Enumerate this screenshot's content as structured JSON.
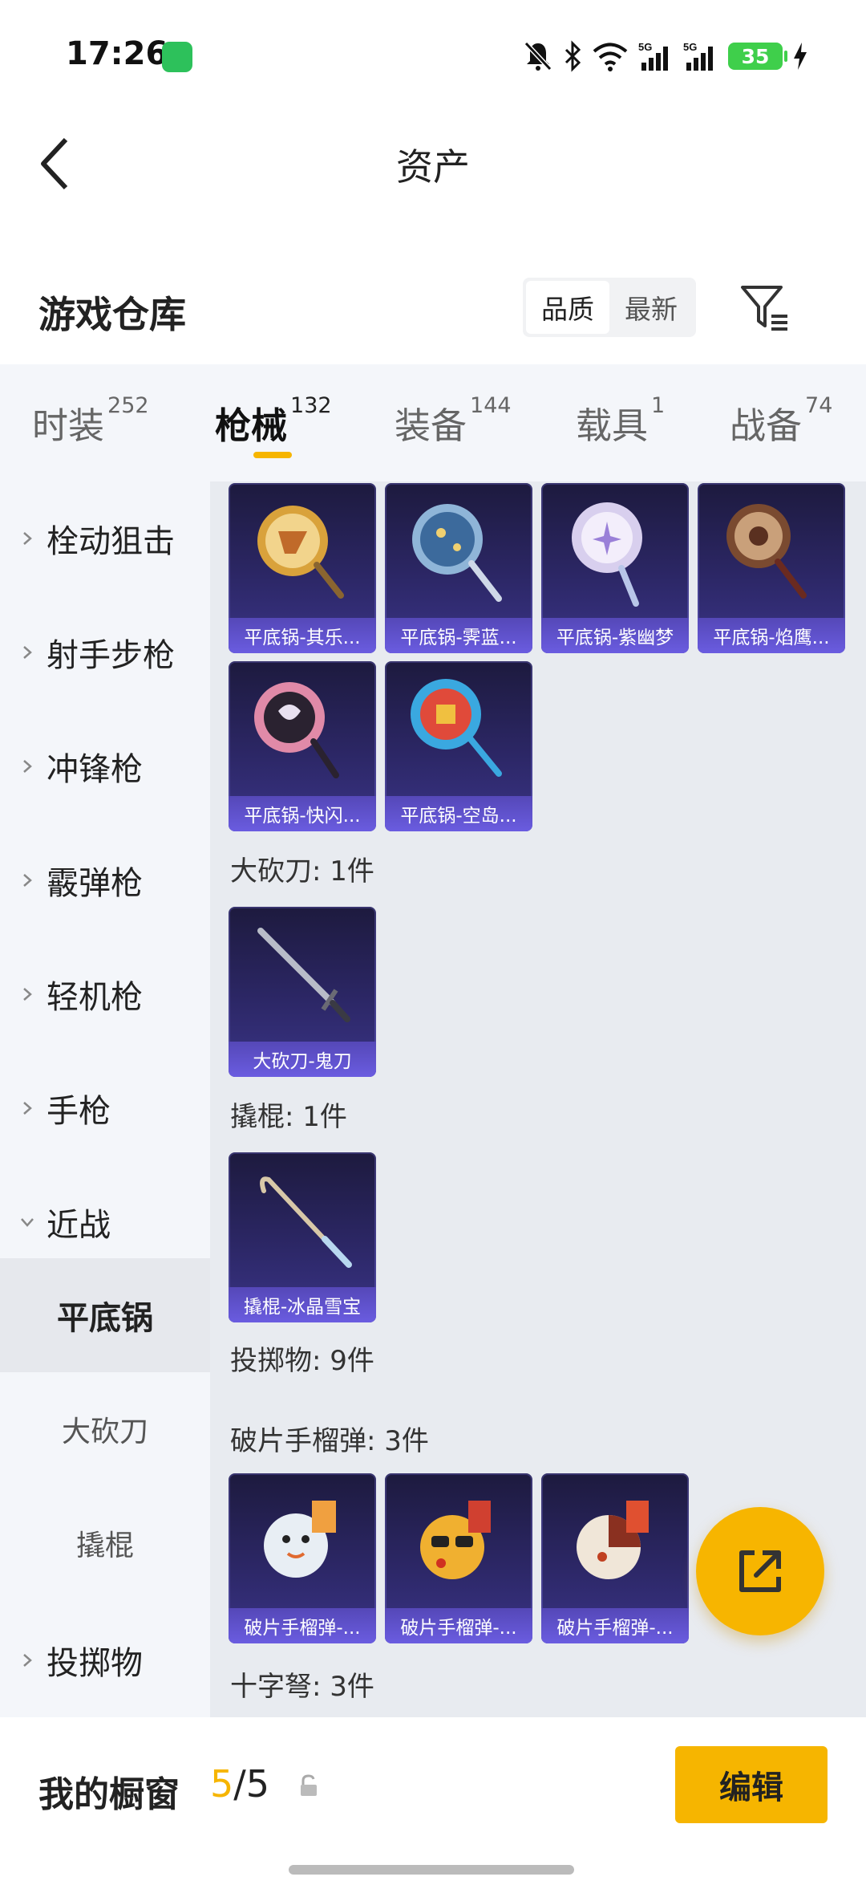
{
  "status": {
    "time": "17:26",
    "battery": "35"
  },
  "header": {
    "title": "资产"
  },
  "section": {
    "title": "游戏仓库",
    "sort_options": [
      "品质",
      "最新"
    ]
  },
  "tabs": [
    {
      "label": "时装",
      "count": "252"
    },
    {
      "label": "枪械",
      "count": "132"
    },
    {
      "label": "装备",
      "count": "144"
    },
    {
      "label": "载具",
      "count": "1"
    },
    {
      "label": "战备",
      "count": "74"
    }
  ],
  "sidebar": {
    "items": [
      "栓动狙击",
      "射手步枪",
      "冲锋枪",
      "霰弹枪",
      "轻机枪",
      "手枪",
      "近战",
      "平底锅",
      "大砍刀",
      "撬棍",
      "投掷物"
    ]
  },
  "content": {
    "pans": [
      "平底锅-其乐...",
      "平底锅-霁蓝...",
      "平底锅-紫幽梦",
      "平底锅-焰鹰...",
      "平底锅-快闪...",
      "平底锅-空岛..."
    ],
    "machete_label": "大砍刀: 1件",
    "machete": [
      "大砍刀-鬼刀"
    ],
    "crowbar_label": "撬棍: 1件",
    "crowbar": [
      "撬棍-冰晶雪宝"
    ],
    "throwables_label": "投掷物: 9件",
    "grenade_label": "破片手榴弹: 3件",
    "grenades": [
      "破片手榴弹-...",
      "破片手榴弹-...",
      "破片手榴弹-..."
    ],
    "crossbow_label": "十字弩: 3件"
  },
  "bottom": {
    "label": "我的橱窗",
    "count_current": "5",
    "count_total": "/5",
    "edit_label": "编辑"
  },
  "colors": {
    "accent": "#f6b500",
    "card_bg": "#2c2766",
    "caption_bg": "#6a5ce0"
  }
}
